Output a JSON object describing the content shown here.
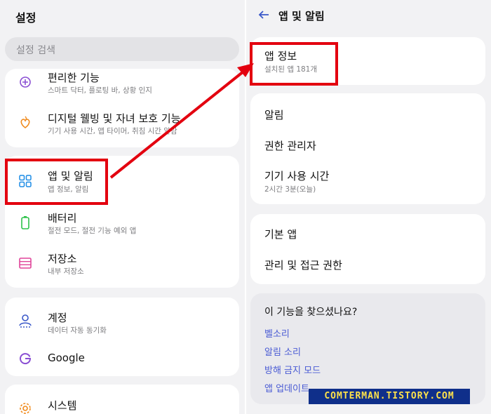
{
  "left": {
    "title": "설정",
    "search_placeholder": "설정 검색",
    "items": [
      {
        "label": "편리한 기능",
        "sub": "스마트 닥터, 플로팅 바, 상황 인지",
        "icon": "sparkle-gear-icon"
      },
      {
        "label": "디지털 웰빙 및 자녀 보호 기능",
        "sub": "기기 사용 시간, 앱 타이머, 취침 시간 알람",
        "icon": "heart-leaf-icon"
      },
      {
        "label": "앱 및 알림",
        "sub": "앱 정보, 알림",
        "icon": "apps-grid-icon"
      },
      {
        "label": "배터리",
        "sub": "절전 모드, 절전 기능 예외 앱",
        "icon": "battery-icon"
      },
      {
        "label": "저장소",
        "sub": "내부 저장소",
        "icon": "storage-icon"
      },
      {
        "label": "계정",
        "sub": "데이터 자동 동기화",
        "icon": "account-icon"
      },
      {
        "label": "Google",
        "sub": "",
        "icon": "google-icon"
      },
      {
        "label": "시스템",
        "sub": "",
        "icon": "system-gear-icon"
      }
    ]
  },
  "right": {
    "title": "앱 및 알림",
    "app_info": {
      "label": "앱 정보",
      "sub": "설치된 앱 181개"
    },
    "items": [
      {
        "label": "알림",
        "sub": ""
      },
      {
        "label": "권한 관리자",
        "sub": ""
      },
      {
        "label": "기기 사용 시간",
        "sub": "2시간 3분(오늘)"
      },
      {
        "label": "기본 앱",
        "sub": ""
      },
      {
        "label": "관리 및 접근 권한",
        "sub": ""
      }
    ],
    "suggest": {
      "title": "이 기능을 찾으셨나요?",
      "links": [
        "벨소리",
        "알림 소리",
        "방해 금지 모드",
        "앱 업데이트"
      ]
    }
  },
  "watermark": "COMTERMAN.TISTORY.COM",
  "colors": {
    "highlight": "#e3000f",
    "link": "#4a5bd4",
    "accent_purple": "#8a4fd3"
  }
}
